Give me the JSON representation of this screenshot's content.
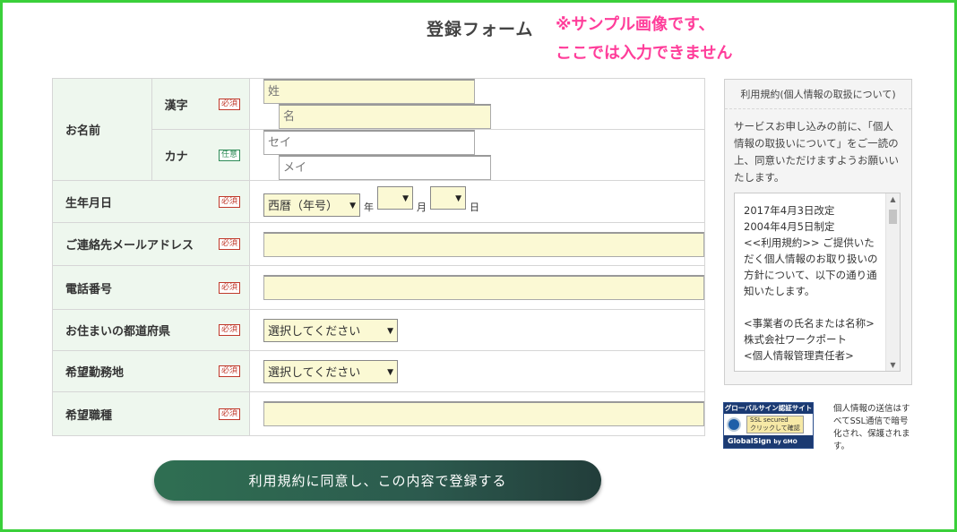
{
  "page_title": "登録フォーム",
  "notice": [
    "※サンプル画像です、",
    "ここでは入力できません"
  ],
  "form": {
    "name": {
      "label": "お名前",
      "kanji": {
        "label": "漢字",
        "badge": "必須",
        "last_placeholder": "姓",
        "first_placeholder": "名"
      },
      "kana": {
        "label": "カナ",
        "badge": "任意",
        "last_placeholder": "セイ",
        "first_placeholder": "メイ"
      }
    },
    "birth": {
      "label": "生年月日",
      "badge": "必須",
      "era_value": "西暦（年号）",
      "year_unit": "年",
      "month_unit": "月",
      "day_unit": "日"
    },
    "email": {
      "label": "ご連絡先メールアドレス",
      "badge": "必須",
      "value": ""
    },
    "phone": {
      "label": "電話番号",
      "badge": "必須",
      "value": ""
    },
    "prefecture": {
      "label": "お住まいの都道府県",
      "badge": "必須",
      "value": "選択してください"
    },
    "work_location": {
      "label": "希望勤務地",
      "badge": "必須",
      "value": "選択してください"
    },
    "job_type": {
      "label": "希望職種",
      "badge": "必須",
      "value": ""
    }
  },
  "terms": {
    "title": "利用規約(個人情報の取扱について)",
    "intro": "サービスお申し込みの前に、「個人情報の取扱いについて」をご一読の上、同意いただけますようお願いいたします。",
    "body": "2017年4月3日改定\n2004年4月5日制定\n<<利用規約>> ご提供いただく個人情報のお取り扱いの方針について、以下の通り通知いたします。\n\n<事業者の氏名または名称>\n株式会社ワークポート\n<個人情報管理責任者>"
  },
  "ssl": {
    "top": "グローバルサイン認証サイト",
    "secured": "SSL secured",
    "check": "クリックして確認",
    "brand": "GlobalSign",
    "by": "by GMO",
    "note": "個人情報の送信はすべてSSL通信で暗号化され、保護されます。"
  },
  "submit_label": "利用規約に同意し、この内容で登録する"
}
